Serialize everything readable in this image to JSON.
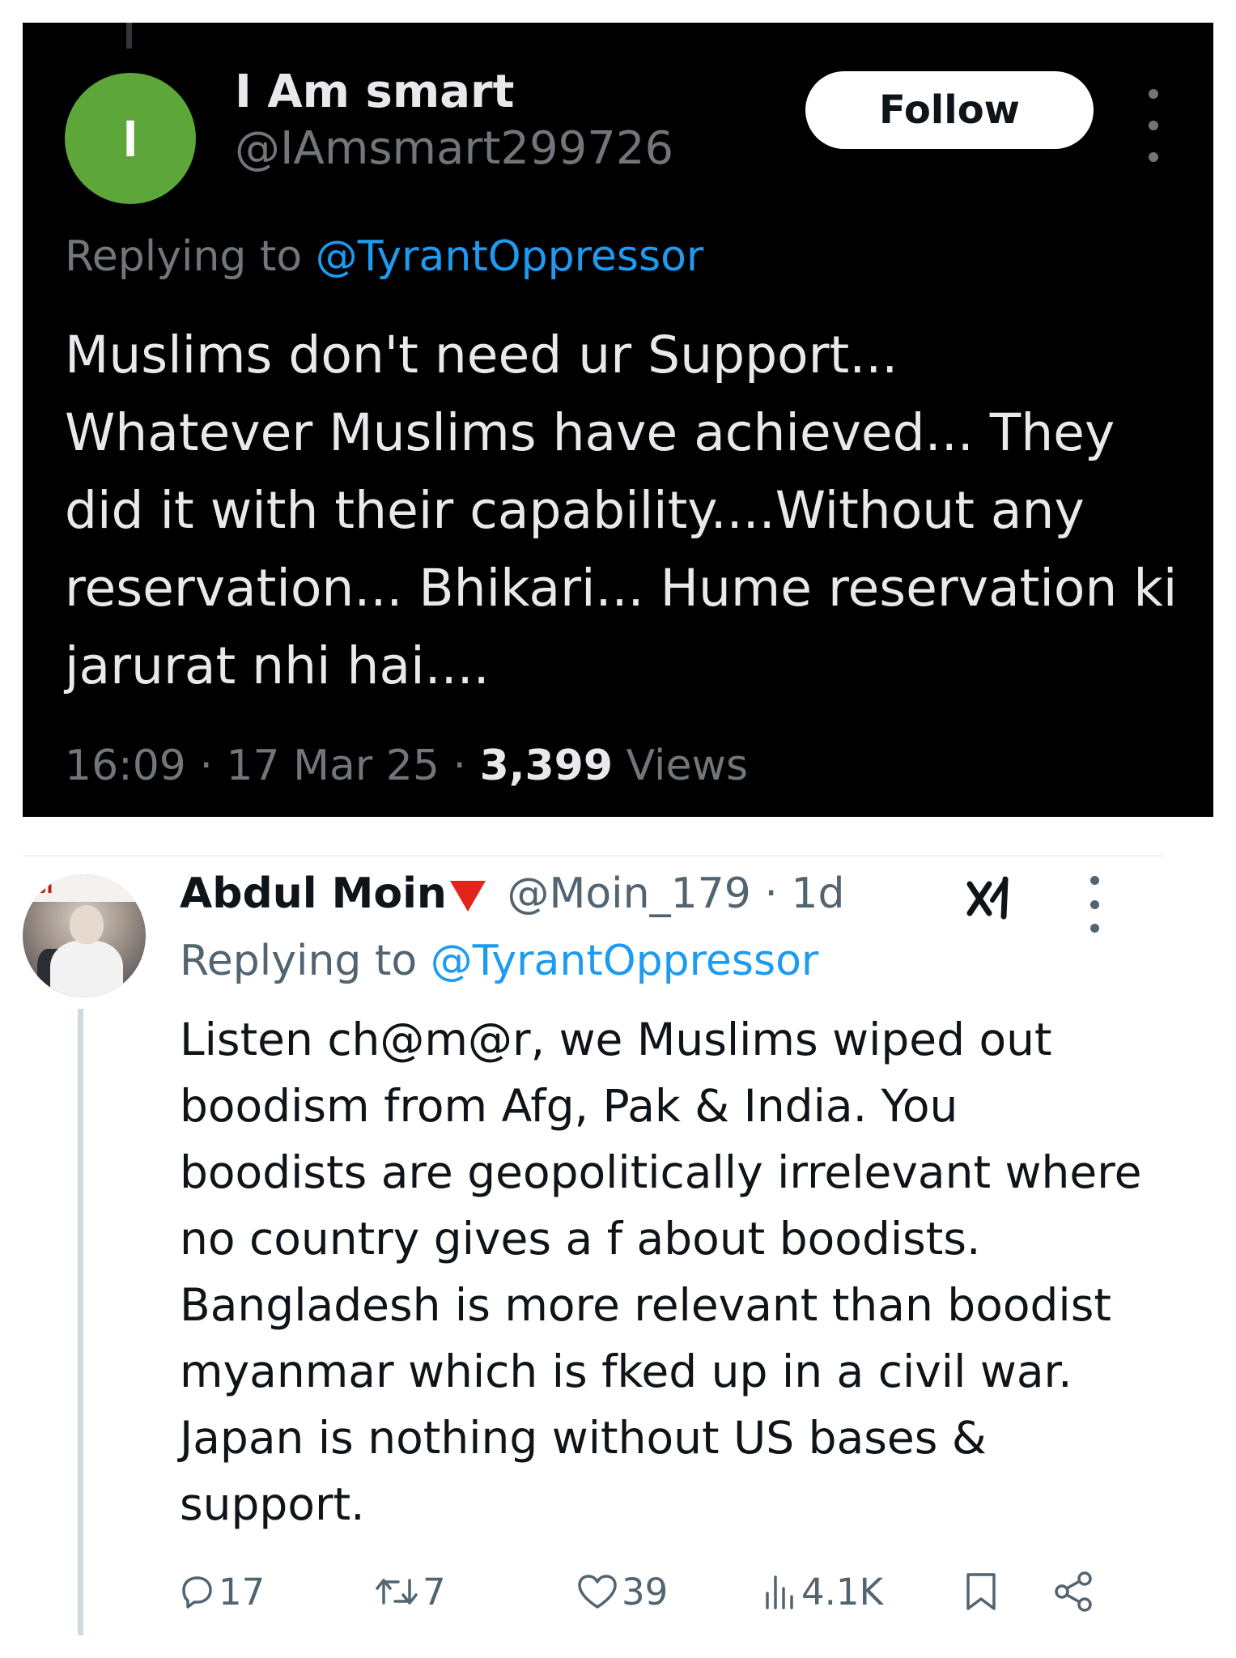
{
  "top_tweet": {
    "avatar_initial": "I",
    "display_name": "I Am smart",
    "handle": "@IAmsmart299726",
    "follow_label": "Follow",
    "replying_prefix": "Replying to ",
    "replying_to": "@TyrantOppressor",
    "text": "Muslims don't need ur Support...\nWhatever Muslims have achieved... They did it with their capability....Without any reservation... Bhikari... Hume reservation ki jarurat nhi hai....",
    "time": "16:09",
    "date": "17 Mar 25",
    "views_count": "3,399",
    "views_label": "Views",
    "colors": {
      "background": "#000000",
      "avatar": "#5ca63a",
      "link": "#1d9bf0"
    }
  },
  "bottom_tweet": {
    "avatar_banner_text": "الـ",
    "display_name": "Abdul Moin",
    "handle": "@Moin_179",
    "time_ago": "1d",
    "replying_prefix": "Replying to ",
    "replying_to": "@TyrantOppressor",
    "text": "Listen ch@m@r, we Muslims wiped out boodism from Afg, Pak & India. You boodists are geopolitically irrelevant where no country gives a f about boodists. Bangladesh is more relevant than boodist myanmar which is fked up in a civil war. Japan is nothing without US bases & support.",
    "actions": {
      "replies": "17",
      "reposts": "7",
      "likes": "39",
      "views": "4.1K"
    },
    "icons": [
      "grok-icon",
      "more-icon",
      "reply-icon",
      "repost-icon",
      "like-icon",
      "views-icon",
      "bookmark-icon",
      "share-icon"
    ],
    "colors": {
      "badge": "#e0261b",
      "link": "#1d9bf0",
      "muted": "#536471"
    }
  }
}
